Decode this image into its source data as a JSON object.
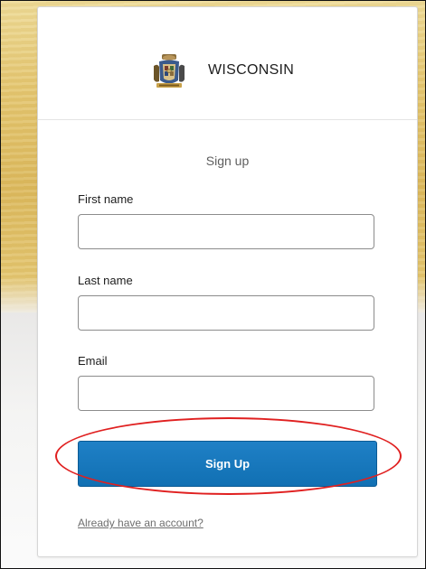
{
  "header": {
    "brand": "WISCONSIN",
    "seal_icon": "wisconsin-state-seal-icon"
  },
  "form": {
    "title": "Sign up",
    "fields": [
      {
        "label": "First name",
        "value": "",
        "placeholder": ""
      },
      {
        "label": "Last name",
        "value": "",
        "placeholder": ""
      },
      {
        "label": "Email",
        "value": "",
        "placeholder": ""
      }
    ],
    "submit_label": "Sign Up",
    "account_link": "Already have an account?"
  },
  "colors": {
    "primary_button": "#1170b3",
    "annotation": "#e02020",
    "background_gold": "#dcb95d"
  }
}
